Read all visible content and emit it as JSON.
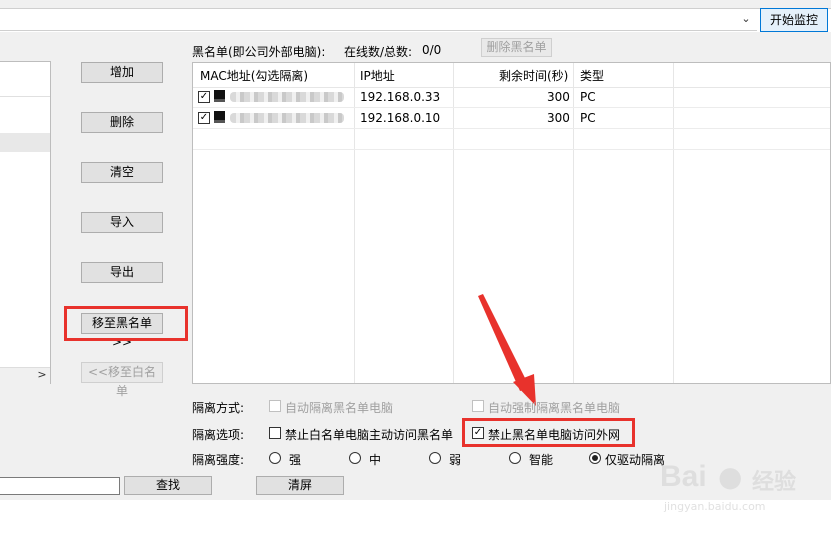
{
  "toolbar": {
    "start_label": "开始监控"
  },
  "buttons": {
    "add": "增加",
    "delete": "删除",
    "clear": "清空",
    "import": "导入",
    "export": "导出",
    "move_black": "移至黑名单>>",
    "move_white": "<<移至白名单",
    "delete_blacklist": "删除黑名单",
    "find": "查找",
    "clear_screen": "清屏"
  },
  "blacklist": {
    "title": "黑名单(即公司外部电脑):",
    "online_label": "在线数/总数:",
    "online_value": "0/0",
    "columns": [
      "MAC地址(勾选隔离)",
      "IP地址",
      "剩余时间(秒)",
      "类型"
    ],
    "rows": [
      {
        "ip": "192.168.0.33",
        "time": "300",
        "type": "PC"
      },
      {
        "ip": "192.168.0.10",
        "time": "300",
        "type": "PC"
      }
    ]
  },
  "options": {
    "isolation_mode_label": "隔离方式:",
    "auto_isolate": "自动隔离黑名单电脑",
    "force_isolate": "自动强制隔离黑名单电脑",
    "isolation_options_label": "隔离选项:",
    "forbid_white": "禁止白名单电脑主动访问黑名单",
    "forbid_black_internet": "禁止黑名单电脑访问外网",
    "strength_label": "隔离强度:",
    "strengths": [
      "强",
      "中",
      "弱",
      "智能",
      "仅驱动隔离"
    ]
  },
  "left_list": {
    "scroll_arrow": ">"
  },
  "watermark": {
    "brand": "Bai",
    "brand2": "经验",
    "url": "jingyan.baidu.com"
  },
  "colors": {
    "highlight": "#e8322c",
    "accent": "#0078d7"
  }
}
